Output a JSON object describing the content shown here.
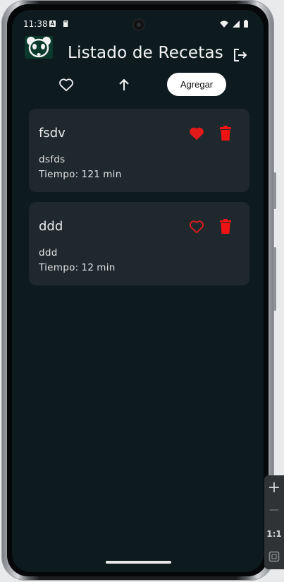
{
  "status_bar": {
    "time": "11:38",
    "icons": [
      "a-notification-icon",
      "sd-card-icon",
      "wifi-icon",
      "signal-icon",
      "battery-icon"
    ]
  },
  "app_bar": {
    "title": "Listado de Recetas",
    "logo_icon": "panda-logo-icon",
    "logout_icon": "logout-icon"
  },
  "toolbar": {
    "favorites_icon": "heart-outline-icon",
    "sort_icon": "arrow-up-icon",
    "add_label": "Agregar"
  },
  "recipes": [
    {
      "name": "fsdv",
      "description": "dsfds",
      "time_label": "Tiempo:",
      "time_value": "121",
      "time_unit": "min",
      "favorite": true
    },
    {
      "name": "ddd",
      "description": "ddd",
      "time_label": "Tiempo:",
      "time_value": "12",
      "time_unit": "min",
      "favorite": false
    }
  ],
  "emulator_controls": {
    "zoom_in": "+",
    "zoom_out": "—",
    "actual_size": "1:1"
  },
  "colors": {
    "background": "#0d1b1f",
    "card": "#1f292d",
    "favorite_red": "#e31a1a",
    "delete_red": "#ef1313",
    "button_bg": "#ffffff"
  }
}
